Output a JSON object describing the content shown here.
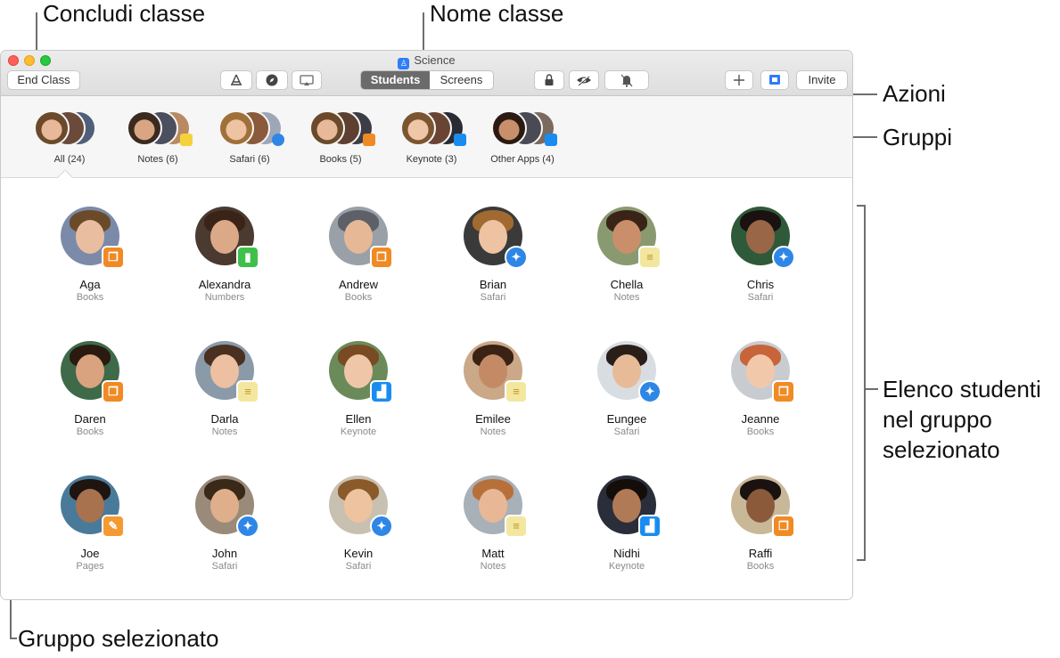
{
  "callouts": {
    "end_class": "Concludi classe",
    "class_name": "Nome classe",
    "actions": "Azioni",
    "groups": "Gruppi",
    "student_list_1": "Elenco studenti",
    "student_list_2": "nel gruppo",
    "student_list_3": "selezionato",
    "selected_group": "Gruppo selezionato"
  },
  "window": {
    "title": "Science",
    "app_icon": "classroom-icon",
    "toolbar": {
      "end_class_label": "End Class",
      "open_app_icon": "app-store-icon",
      "navigate_icon": "compass-icon",
      "airplay_icon": "airplay-icon",
      "tabs": [
        "Students",
        "Screens"
      ],
      "selected_tab": "Students",
      "lock_icon": "lock-icon",
      "hide_icon": "eye-slash-icon",
      "mute_icon": "bell-slash-icon",
      "add_icon": "plus-icon",
      "screen_icon": "screen-icon",
      "invite_label": "Invite"
    }
  },
  "groups": [
    {
      "label": "All (24)",
      "badge_color": ""
    },
    {
      "label": "Notes (6)",
      "badge_color": "#f5d23c"
    },
    {
      "label": "Safari (6)",
      "badge_color": "#2e86e6"
    },
    {
      "label": "Books (5)",
      "badge_color": "#f08a24"
    },
    {
      "label": "Keynote (3)",
      "badge_color": "#1a8cf0"
    },
    {
      "label": "Other Apps (4)",
      "badge_color": "#1a8cf0"
    }
  ],
  "selected_group": "All (24)",
  "app_colors": {
    "Books": "#f08a24",
    "Numbers": "#3ec04a",
    "Safari": "#2e86e6",
    "Notes": "#f3e7a0",
    "Keynote": "#1a8cf0",
    "Pages": "#f59a30"
  },
  "students": [
    {
      "name": "Aga",
      "app": "Books"
    },
    {
      "name": "Alexandra",
      "app": "Numbers"
    },
    {
      "name": "Andrew",
      "app": "Books"
    },
    {
      "name": "Brian",
      "app": "Safari"
    },
    {
      "name": "Chella",
      "app": "Notes"
    },
    {
      "name": "Chris",
      "app": "Safari"
    },
    {
      "name": "Daren",
      "app": "Books"
    },
    {
      "name": "Darla",
      "app": "Notes"
    },
    {
      "name": "Ellen",
      "app": "Keynote"
    },
    {
      "name": "Emilee",
      "app": "Notes"
    },
    {
      "name": "Eungee",
      "app": "Safari"
    },
    {
      "name": "Jeanne",
      "app": "Books"
    },
    {
      "name": "Joe",
      "app": "Pages"
    },
    {
      "name": "John",
      "app": "Safari"
    },
    {
      "name": "Kevin",
      "app": "Safari"
    },
    {
      "name": "Matt",
      "app": "Notes"
    },
    {
      "name": "Nidhi",
      "app": "Keynote"
    },
    {
      "name": "Raffi",
      "app": "Books"
    }
  ]
}
